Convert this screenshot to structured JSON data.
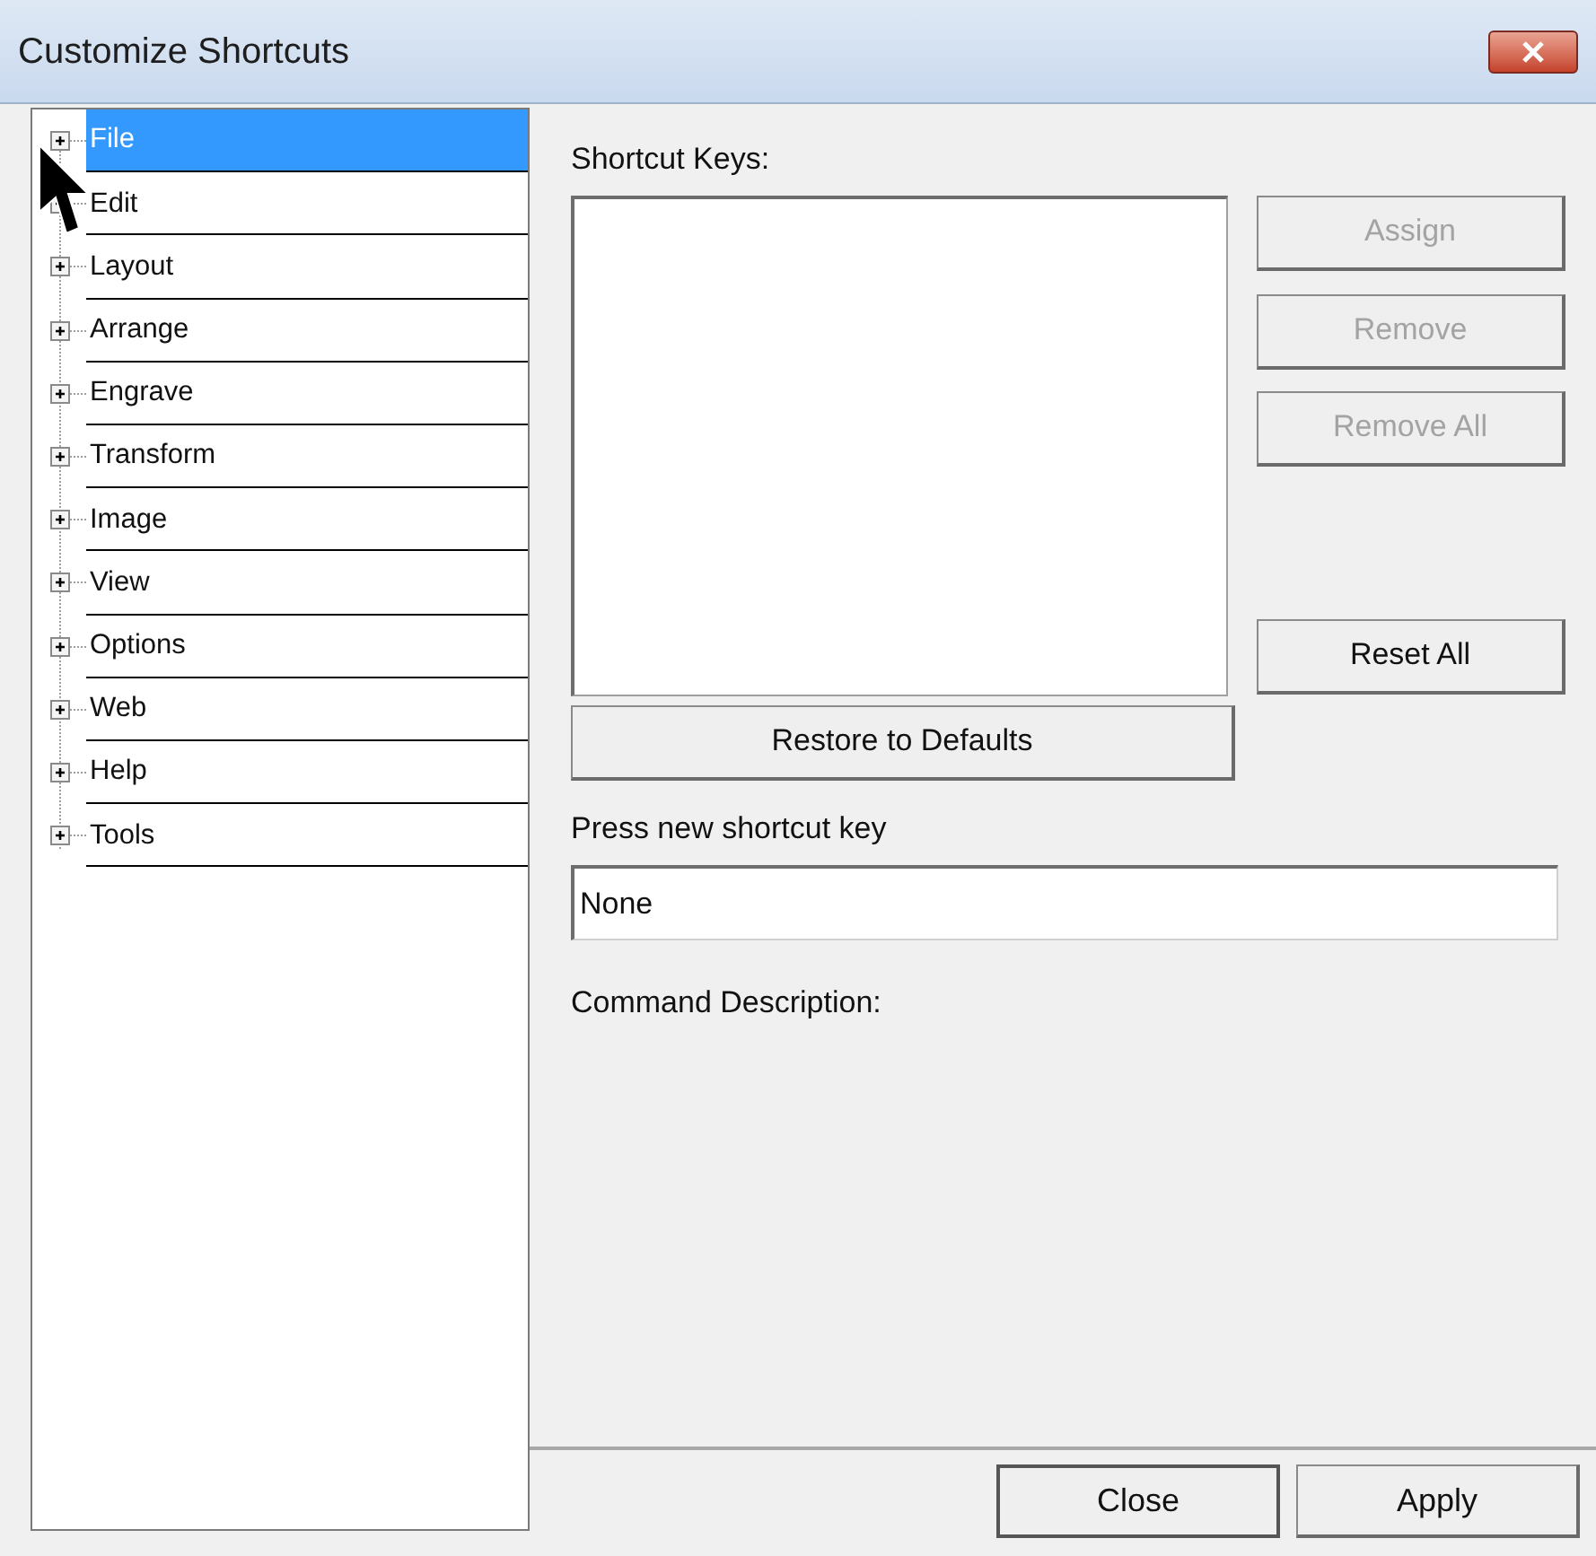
{
  "window": {
    "title": "Customize Shortcuts"
  },
  "tree": {
    "items": [
      {
        "label": "File",
        "selected": true
      },
      {
        "label": "Edit",
        "selected": false
      },
      {
        "label": "Layout",
        "selected": false
      },
      {
        "label": "Arrange",
        "selected": false
      },
      {
        "label": "Engrave",
        "selected": false
      },
      {
        "label": "Transform",
        "selected": false
      },
      {
        "label": "Image",
        "selected": false
      },
      {
        "label": "View",
        "selected": false
      },
      {
        "label": "Options",
        "selected": false
      },
      {
        "label": "Web",
        "selected": false
      },
      {
        "label": "Help",
        "selected": false
      },
      {
        "label": "Tools",
        "selected": false
      }
    ]
  },
  "shortcut_keys": {
    "label": "Shortcut Keys:"
  },
  "side_buttons": [
    {
      "label": "Assign",
      "disabled": true
    },
    {
      "label": "Remove",
      "disabled": true
    },
    {
      "label": "Remove All",
      "disabled": true
    },
    {
      "label": "Reset All",
      "disabled": false
    }
  ],
  "restore_button": {
    "label": "Restore to Defaults"
  },
  "new_key": {
    "label": "Press new shortcut key",
    "value": "None"
  },
  "description": {
    "label": "Command Description:"
  },
  "footer_buttons": [
    {
      "label": "Close",
      "default": true
    },
    {
      "label": "Apply",
      "default": false
    }
  ]
}
